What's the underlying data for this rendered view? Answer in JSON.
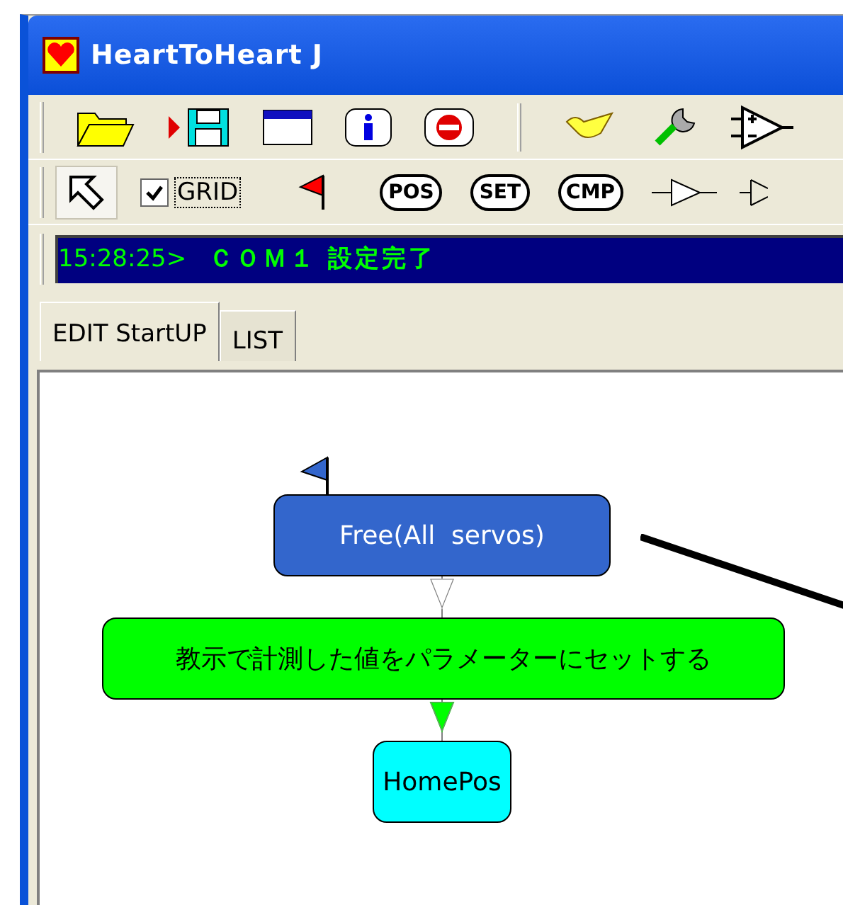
{
  "window": {
    "title": "HeartToHeart J"
  },
  "toolbar_2": {
    "pointer_tool": {
      "selected": true
    },
    "grid": {
      "label": "GRID",
      "checked": true
    },
    "buttons": [
      "POS",
      "SET",
      "CMP"
    ]
  },
  "status": {
    "time": "15:28:25>",
    "message": "ＣＯＭ１ 設定完了"
  },
  "tabs": [
    {
      "label": "EDIT StartUP",
      "selected": true
    },
    {
      "label": "LIST",
      "selected": false
    }
  ],
  "flow": {
    "nodes": [
      {
        "label": "Free(All  servos)",
        "color": "#3366cc"
      },
      {
        "label": "教示で計測した値をパラメーターにセットする",
        "color": "#00ff00"
      },
      {
        "label": "HomePos",
        "color": "#00ffff"
      }
    ],
    "connectors": [
      {
        "color": "#ffffff"
      },
      {
        "color": "#00ff00"
      }
    ]
  }
}
